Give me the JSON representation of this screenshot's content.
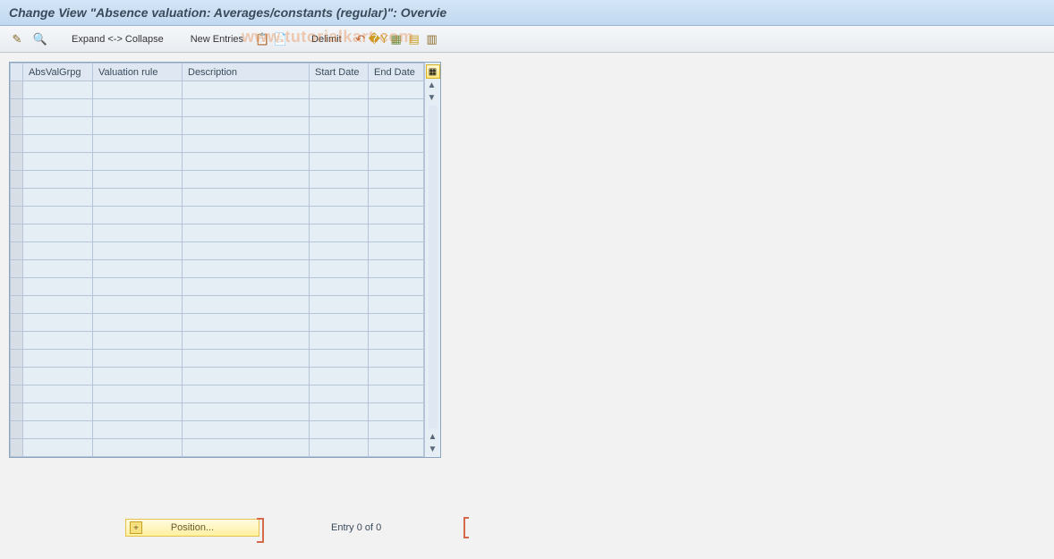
{
  "title": "Change View \"Absence valuation: Averages/constants (regular)\": Overvie",
  "toolbar": {
    "expand_collapse": "Expand <-> Collapse",
    "new_entries": "New Entries",
    "delimit": "Delimit",
    "icons": {
      "change": "pencil-glasses-icon",
      "find": "magnifier-icon",
      "copy": "copy-icon",
      "paste": "paste-icon",
      "undo": "undo-icon",
      "next": "next-entry-icon",
      "select_all": "select-all-icon",
      "save1": "table-save-icon",
      "save2": "table-settings-icon"
    }
  },
  "watermark": "www.tutorialkart.com",
  "table": {
    "columns": [
      "AbsValGrpg",
      "Valuation rule",
      "Description",
      "Start Date",
      "End Date"
    ],
    "rows": 21
  },
  "footer": {
    "position_label": "Position...",
    "entry_text": "Entry 0 of 0"
  },
  "colors": {
    "header_bg": "#d4e5f7",
    "grid_border": "#b5c4d6",
    "accent_yellow": "#fff0a0",
    "bracket": "#d46a4a"
  }
}
